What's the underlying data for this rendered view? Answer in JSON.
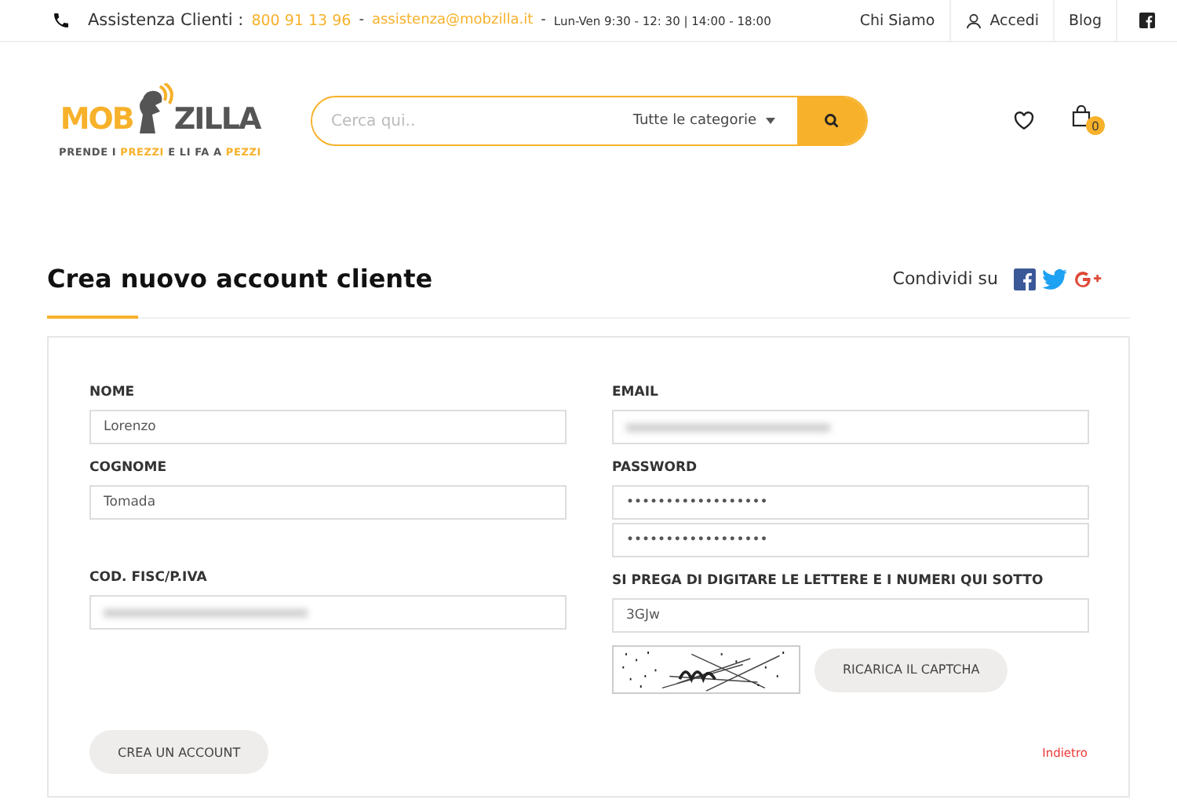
{
  "top_bar": {
    "support_label": "Assistenza Clienti :",
    "phone": "800 91 13 96",
    "separator_1": "-",
    "email": "assistenza@mobzilla.it",
    "separator_2": "-",
    "hours": "Lun-Ven 9:30 - 12: 30 | 14:00 - 18:00",
    "links": [
      {
        "label": "Chi Siamo",
        "kind": "text"
      },
      {
        "label": "Accedi",
        "kind": "user"
      },
      {
        "label": "Blog",
        "kind": "text"
      }
    ]
  },
  "logo": {
    "left": "MOB",
    "right": "ZILLA",
    "tagline": [
      {
        "text": "PRENDE I ",
        "highlight": false
      },
      {
        "text": "PREZZI",
        "highlight": true
      },
      {
        "text": " E LI FA A ",
        "highlight": false
      },
      {
        "text": "PEZZI",
        "highlight": true
      }
    ]
  },
  "search": {
    "placeholder": "Cerca qui..",
    "category": "Tutte le categorie"
  },
  "cart": {
    "count": "0"
  },
  "page_title": "Crea nuovo account cliente",
  "share": {
    "label": "Condividi su"
  },
  "form": {
    "left": [
      {
        "label": "NOME",
        "value": "Lorenzo",
        "kind": "text"
      },
      {
        "label": "COGNOME",
        "value": "Tomada",
        "kind": "text"
      },
      {
        "label": "COD. FISC/P.IVA",
        "kind": "blurred"
      }
    ],
    "right": [
      {
        "label": "EMAIL",
        "kind": "blurred"
      },
      {
        "label": "PASSWORD",
        "value": "••••••••••••••••••",
        "kind": "password"
      },
      {
        "value": "••••••••••••••••••",
        "kind": "password"
      },
      {
        "label": "SI PREGA DI DIGITARE LE LETTERE E I NUMERI QUI SOTTO",
        "value": "3GJw",
        "kind": "text"
      }
    ],
    "reload_button": "RICARICA IL CAPTCHA",
    "submit_button": "CREA UN ACCOUNT",
    "back_link": "Indietro"
  }
}
